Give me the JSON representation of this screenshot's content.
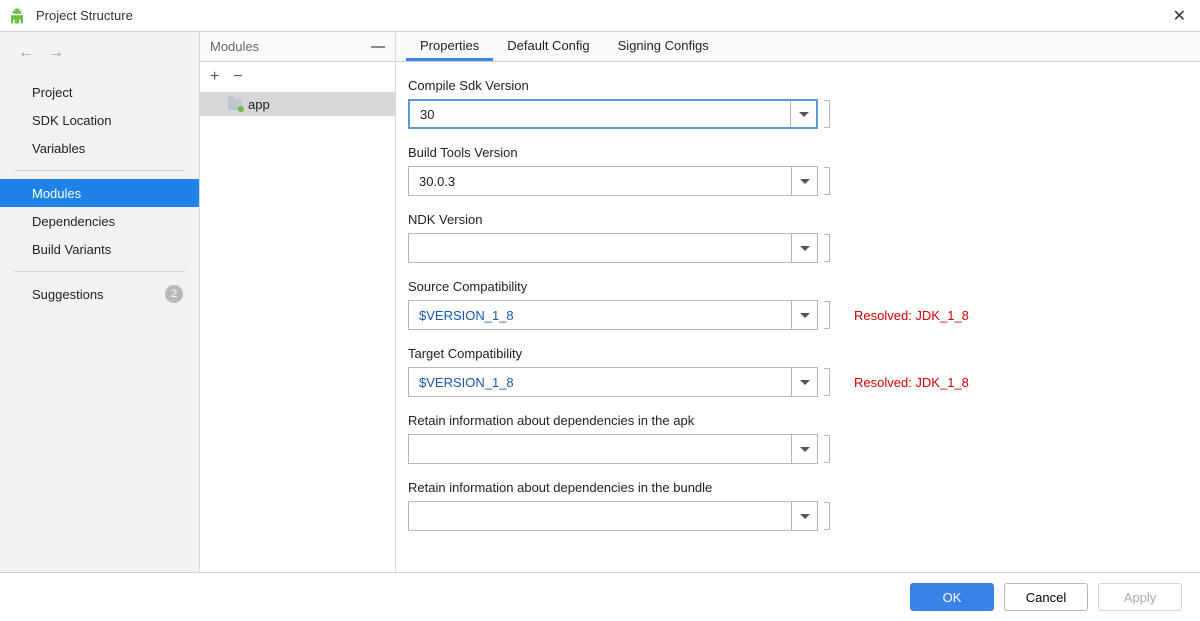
{
  "window": {
    "title": "Project Structure"
  },
  "sidebar": {
    "items": [
      {
        "label": "Project"
      },
      {
        "label": "SDK Location"
      },
      {
        "label": "Variables"
      }
    ],
    "items2": [
      {
        "label": "Modules"
      },
      {
        "label": "Dependencies"
      },
      {
        "label": "Build Variants"
      }
    ],
    "suggestions": {
      "label": "Suggestions",
      "count": "2"
    }
  },
  "modules": {
    "header": "Modules",
    "items": [
      {
        "name": "app"
      }
    ]
  },
  "tabs": [
    {
      "label": "Properties"
    },
    {
      "label": "Default Config"
    },
    {
      "label": "Signing Configs"
    }
  ],
  "fields": {
    "compileSdk": {
      "label": "Compile Sdk Version",
      "value": "30"
    },
    "buildTools": {
      "label": "Build Tools Version",
      "value": "30.0.3"
    },
    "ndk": {
      "label": "NDK Version",
      "value": ""
    },
    "sourceCompat": {
      "label": "Source Compatibility",
      "value": "$VERSION_1_8",
      "resolved": "Resolved: JDK_1_8"
    },
    "targetCompat": {
      "label": "Target Compatibility",
      "value": "$VERSION_1_8",
      "resolved": "Resolved: JDK_1_8"
    },
    "retainApk": {
      "label": "Retain information about dependencies in the apk",
      "value": ""
    },
    "retainBundle": {
      "label": "Retain information about dependencies in the bundle",
      "value": ""
    }
  },
  "footer": {
    "ok": "OK",
    "cancel": "Cancel",
    "apply": "Apply"
  }
}
